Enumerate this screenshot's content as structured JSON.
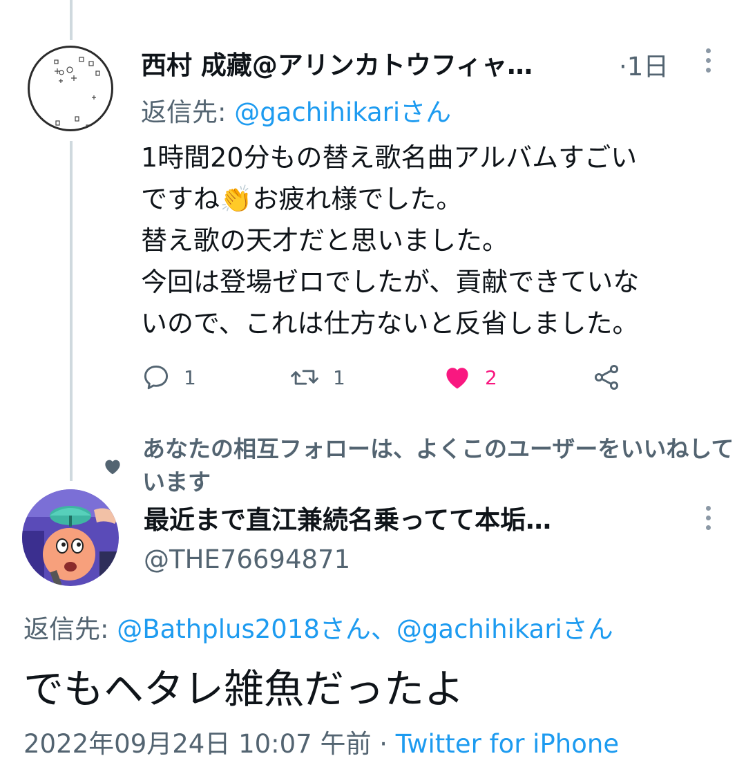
{
  "parent_tweet": {
    "display_name": "西村 成藏@アリンカトウフィャ…",
    "time_sep": "·",
    "time": "1日",
    "reply_prefix": "返信先: ",
    "reply_to": "@gachihikariさん",
    "text_lines": [
      "1時間20分もの替え歌名曲アルバムすごい",
      "ですね",
      "お疲れ様でした。",
      "替え歌の天才だと思いました。",
      "今回は登場ゼロでしたが、貢献できていな",
      "いので、これは仕方ないと反省しました。"
    ],
    "emoji": "👏",
    "actions": {
      "reply_count": "1",
      "retweet_count": "1",
      "like_count": "2"
    }
  },
  "social_context": "あなたの相互フォローは、よくこのユーザーをいいねしています",
  "focused_tweet": {
    "display_name": "最近まで直江兼続名乗ってて本垢…",
    "handle": "@THE76694871",
    "reply_prefix": "返信先: ",
    "reply_to_1": "@Bathplus2018さん",
    "reply_separator": "、",
    "reply_to_2": "@gachihikariさん",
    "text": "でもヘタレ雑魚だったよ",
    "timestamp": "2022年09月24日 10:07 午前",
    "meta_sep": " · ",
    "source": "Twitter for iPhone"
  },
  "colors": {
    "link": "#1d9bf0",
    "like": "#f91880",
    "secondary": "#536471",
    "thread_line": "#cfd9de"
  }
}
